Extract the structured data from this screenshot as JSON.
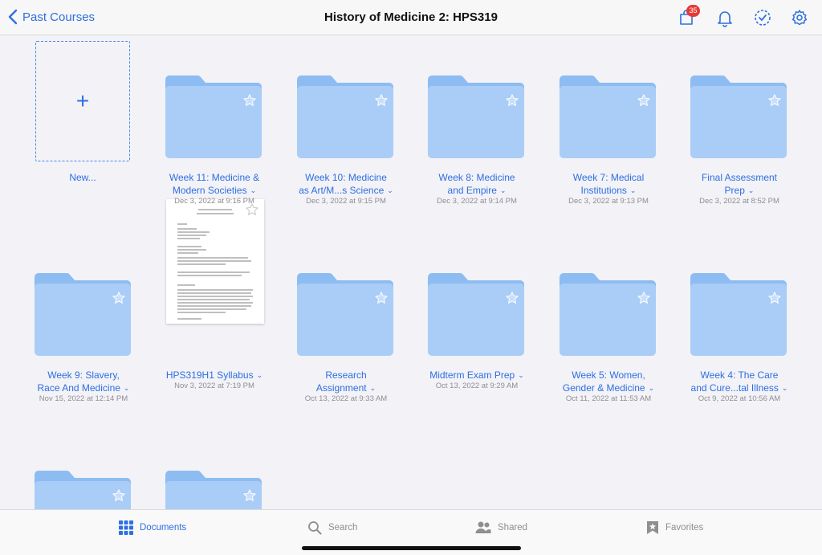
{
  "header": {
    "back_label": "Past Courses",
    "title": "History of Medicine 2: HPS319",
    "cart_badge": "35",
    "accent": "#2f6fe0"
  },
  "new_item": {
    "label": "New..."
  },
  "items": [
    {
      "type": "folder",
      "name_line1": "Week 11: Medicine &",
      "name_line2": "Modern Societies",
      "date": "Dec 3, 2022 at 9:16 PM"
    },
    {
      "type": "folder",
      "name_line1": "Week 10: Medicine",
      "name_line2": "as Art/M...s Science",
      "date": "Dec 3, 2022 at 9:15 PM"
    },
    {
      "type": "folder",
      "name_line1": "Week 8: Medicine",
      "name_line2": "and Empire",
      "date": "Dec 3, 2022 at 9:14 PM"
    },
    {
      "type": "folder",
      "name_line1": "Week 7: Medical",
      "name_line2": "Institutions",
      "date": "Dec 3, 2022 at 9:13 PM"
    },
    {
      "type": "folder",
      "name_line1": "Final Assessment",
      "name_line2": "Prep",
      "date": "Dec 3, 2022 at 8:52 PM"
    },
    {
      "type": "folder",
      "name_line1": "Week 9: Slavery,",
      "name_line2": "Race And Medicine",
      "date": "Nov 15, 2022 at 12:14 PM"
    },
    {
      "type": "document",
      "name_line1": "HPS319H1 Syllabus",
      "name_line2": "",
      "date": "Nov 3, 2022 at 7:19 PM"
    },
    {
      "type": "folder",
      "name_line1": "Research",
      "name_line2": "Assignment",
      "date": "Oct 13, 2022 at 9:33 AM"
    },
    {
      "type": "folder",
      "name_line1": "Midterm Exam Prep",
      "name_line2": "",
      "date": "Oct 13, 2022 at 9:29 AM"
    },
    {
      "type": "folder",
      "name_line1": "Week 5: Women,",
      "name_line2": "Gender & Medicine",
      "date": "Oct 11, 2022 at 11:53 AM"
    },
    {
      "type": "folder",
      "name_line1": "Week 4: The Care",
      "name_line2": "and Cure...tal Illness",
      "date": "Oct 9, 2022 at 10:56 AM"
    },
    {
      "type": "folder",
      "name_line1": "",
      "name_line2": "",
      "date": ""
    },
    {
      "type": "folder",
      "name_line1": "",
      "name_line2": "",
      "date": ""
    }
  ],
  "tabbar": {
    "documents": "Documents",
    "search": "Search",
    "shared": "Shared",
    "favorites": "Favorites"
  },
  "colors": {
    "folder_body": "#a9cdf7",
    "folder_tab": "#8dbcf2",
    "inactive": "#8e8e93"
  }
}
